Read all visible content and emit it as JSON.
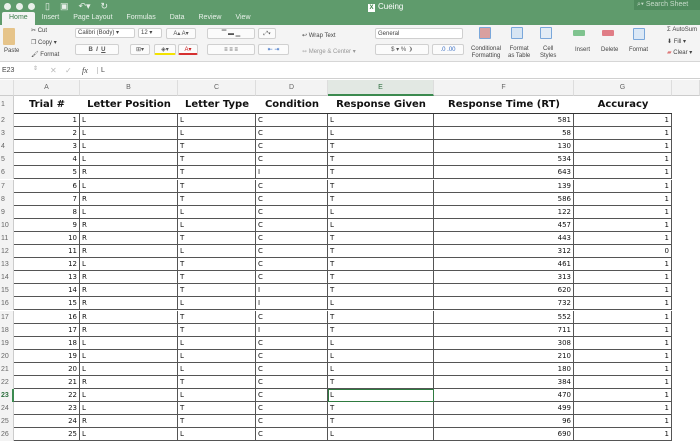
{
  "window": {
    "title": "Cueing",
    "search_placeholder": "Search Sheet"
  },
  "tabs": [
    "Home",
    "Insert",
    "Page Layout",
    "Formulas",
    "Data",
    "Review",
    "View"
  ],
  "ribbon": {
    "paste": "Paste",
    "cut": "Cut",
    "copy": "Copy",
    "format_painter": "Format",
    "font_name": "Calibri (Body)",
    "font_size": "12",
    "bold": "B",
    "italic": "I",
    "underline": "U",
    "wrap_text": "Wrap Text",
    "merge_center": "Merge & Center",
    "number_format": "General",
    "currency": "$",
    "percent": "%",
    "comma": "❩",
    "conditional_formatting": [
      "Conditional",
      "Formatting"
    ],
    "format_as_table": [
      "Format",
      "as Table"
    ],
    "cell_styles": [
      "Cell",
      "Styles"
    ],
    "insert": "Insert",
    "delete": "Delete",
    "format": "Format",
    "autosum": "AutoSum",
    "fill": "Fill",
    "clear": "Clear"
  },
  "formula_bar": {
    "name_box": "E23",
    "fx": "fx",
    "value": "L"
  },
  "columns": [
    "A",
    "B",
    "C",
    "D",
    "E",
    "F",
    "G"
  ],
  "selected_cell": {
    "column": "E",
    "row": 23
  },
  "headers": [
    "Trial #",
    "Letter Position",
    "Letter Type",
    "Condition",
    "Response Given",
    "Response Time (RT)",
    "Accuracy"
  ],
  "rows": [
    [
      1,
      "L",
      "L",
      "C",
      "L",
      581,
      1
    ],
    [
      2,
      "L",
      "L",
      "C",
      "L",
      58,
      1
    ],
    [
      3,
      "L",
      "T",
      "C",
      "T",
      130,
      1
    ],
    [
      4,
      "L",
      "T",
      "C",
      "T",
      534,
      1
    ],
    [
      5,
      "R",
      "T",
      "I",
      "T",
      643,
      1
    ],
    [
      6,
      "L",
      "T",
      "C",
      "T",
      139,
      1
    ],
    [
      7,
      "R",
      "T",
      "C",
      "T",
      586,
      1
    ],
    [
      8,
      "L",
      "L",
      "C",
      "L",
      122,
      1
    ],
    [
      9,
      "R",
      "L",
      "C",
      "L",
      457,
      1
    ],
    [
      10,
      "R",
      "T",
      "C",
      "T",
      443,
      1
    ],
    [
      11,
      "R",
      "L",
      "C",
      "T",
      312,
      0
    ],
    [
      12,
      "L",
      "T",
      "C",
      "T",
      461,
      1
    ],
    [
      13,
      "R",
      "T",
      "C",
      "T",
      313,
      1
    ],
    [
      14,
      "R",
      "T",
      "I",
      "T",
      620,
      1
    ],
    [
      15,
      "R",
      "L",
      "I",
      "L",
      732,
      1
    ],
    [
      16,
      "R",
      "T",
      "C",
      "T",
      552,
      1
    ],
    [
      17,
      "R",
      "T",
      "I",
      "T",
      711,
      1
    ],
    [
      18,
      "L",
      "L",
      "C",
      "L",
      308,
      1
    ],
    [
      19,
      "L",
      "L",
      "C",
      "L",
      210,
      1
    ],
    [
      20,
      "L",
      "L",
      "C",
      "L",
      180,
      1
    ],
    [
      21,
      "R",
      "T",
      "C",
      "T",
      384,
      1
    ],
    [
      22,
      "L",
      "L",
      "C",
      "L",
      470,
      1
    ],
    [
      23,
      "L",
      "T",
      "C",
      "T",
      499,
      1
    ],
    [
      24,
      "R",
      "T",
      "C",
      "T",
      96,
      1
    ],
    [
      25,
      "L",
      "L",
      "C",
      "L",
      690,
      1
    ]
  ]
}
